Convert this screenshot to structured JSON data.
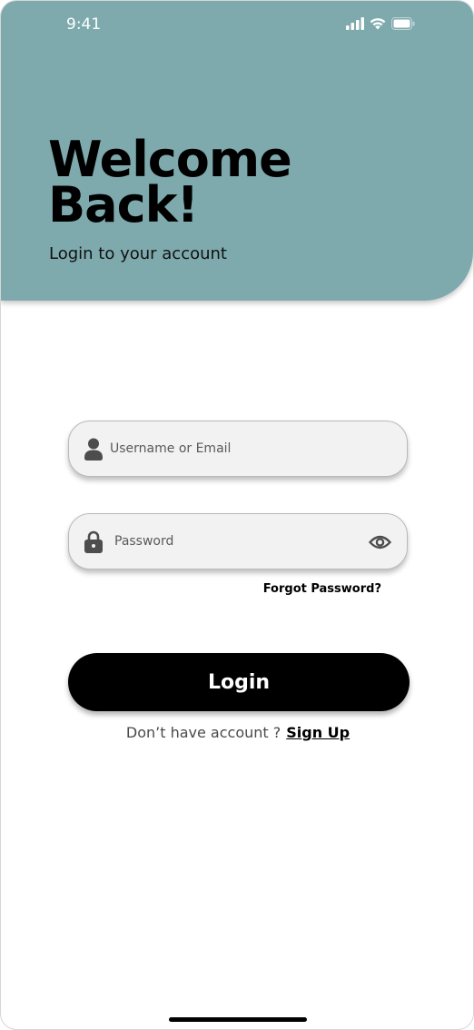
{
  "status_bar": {
    "time": "9:41"
  },
  "header": {
    "title": "Welcome\nBack!",
    "subtitle": "Login to your account",
    "background_color": "#7eaaad"
  },
  "form": {
    "username": {
      "placeholder": "Username or Email",
      "value": "",
      "icon": "user-icon"
    },
    "password": {
      "placeholder": "Password",
      "value": "",
      "icon": "lock-icon",
      "toggle_icon": "eye-icon"
    },
    "forgot_password_label": "Forgot Password?",
    "login_label": "Login"
  },
  "footer": {
    "signup_prompt": "Don’t have account ?",
    "signup_label": "Sign Up"
  },
  "colors": {
    "accent": "#000000",
    "field_background": "#f2f2f2"
  }
}
